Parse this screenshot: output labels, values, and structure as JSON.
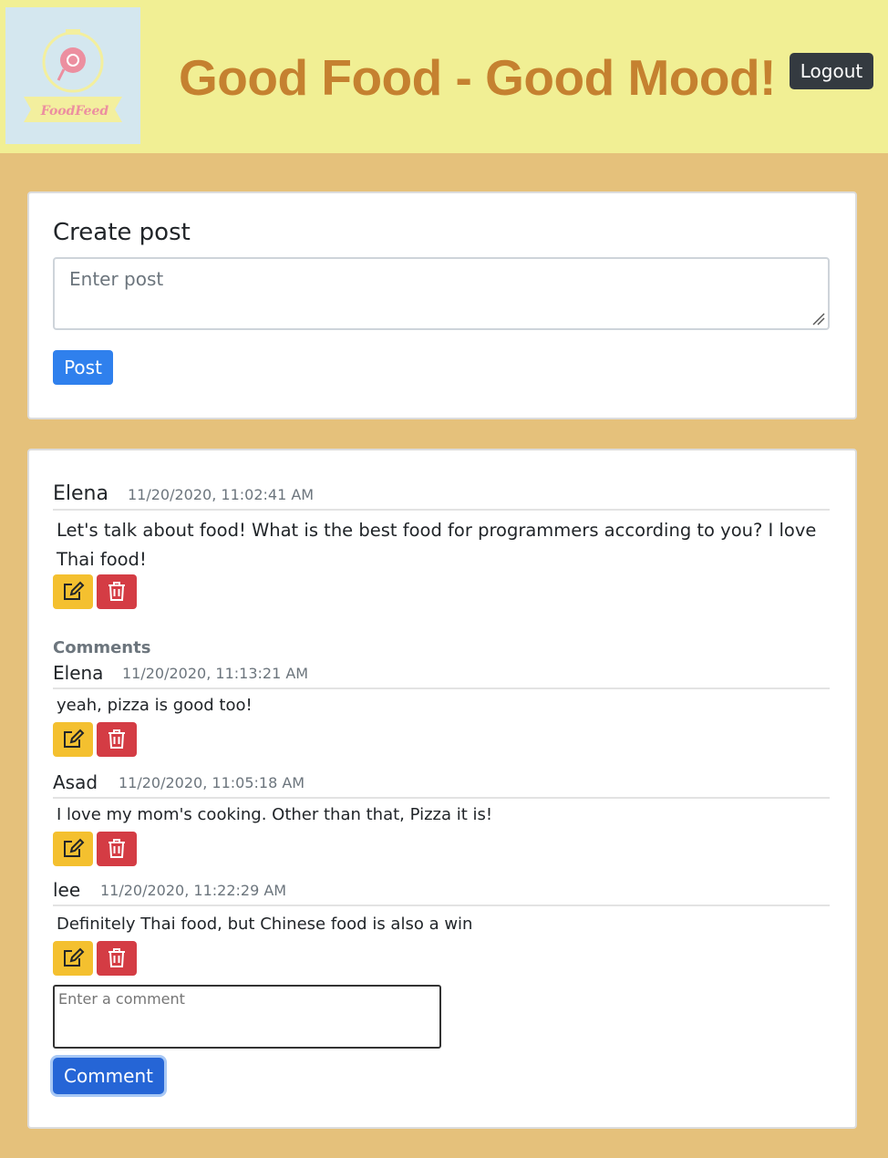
{
  "header": {
    "logo_text": "FoodFeed",
    "title": "Good Food - Good Mood!",
    "logout_label": "Logout"
  },
  "create_post": {
    "title": "Create post",
    "placeholder": "Enter post",
    "post_label": "Post"
  },
  "post": {
    "author": "Elena",
    "timestamp": "11/20/2020, 11:02:41 AM",
    "body": "Let's talk about food! What is the best food for programmers according to you? I love Thai food!"
  },
  "comments": {
    "label": "Comments",
    "items": [
      {
        "author": "Elena",
        "timestamp": "11/20/2020, 11:13:21 AM",
        "body": "yeah, pizza is good too!"
      },
      {
        "author": "Asad",
        "timestamp": "11/20/2020, 11:05:18 AM",
        "body": "I love my mom's cooking. Other than that, Pizza it is!"
      },
      {
        "author": "lee",
        "timestamp": "11/20/2020, 11:22:29 AM",
        "body": "Definitely Thai food, but Chinese food is also a win"
      }
    ],
    "input_placeholder": "Enter a comment",
    "comment_label": "Comment"
  },
  "icons": {
    "edit": "edit-icon",
    "delete": "trash-icon"
  },
  "colors": {
    "header_bg": "#f1ef94",
    "page_bg": "#e5c17b",
    "title": "#c58130",
    "primary": "#2f80ed",
    "warning": "#f4c02f",
    "danger": "#d43c44",
    "dark": "#343a40"
  }
}
